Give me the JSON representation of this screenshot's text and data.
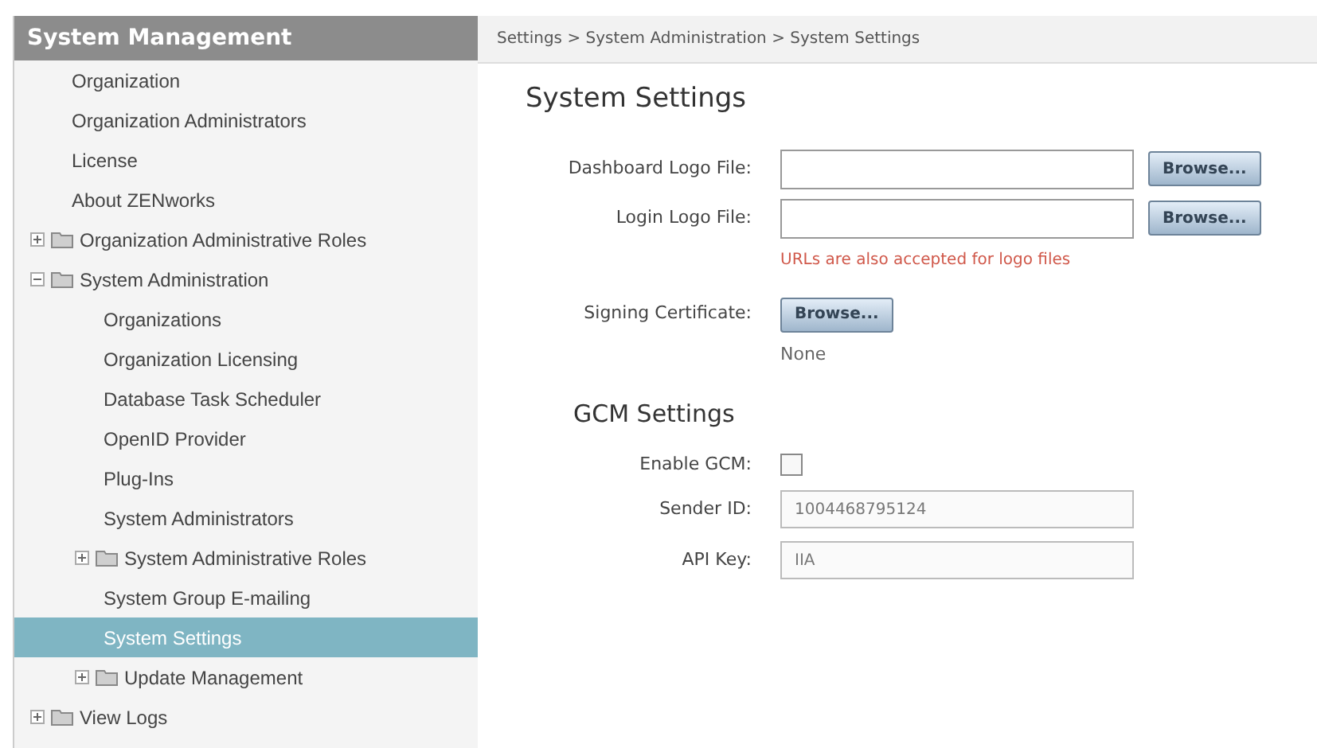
{
  "sidebar": {
    "title": "System Management",
    "items": [
      {
        "label": "Organization",
        "selected": false
      },
      {
        "label": "Organization Administrators",
        "selected": false
      },
      {
        "label": "License",
        "selected": false
      },
      {
        "label": "About ZENworks",
        "selected": false
      },
      {
        "label": "Organization Administrative Roles",
        "selected": false,
        "expanded": false
      },
      {
        "label": "System Administration",
        "selected": false,
        "expanded": true,
        "children": [
          {
            "label": "Organizations",
            "selected": false
          },
          {
            "label": "Organization Licensing",
            "selected": false
          },
          {
            "label": "Database Task Scheduler",
            "selected": false
          },
          {
            "label": "OpenID Provider",
            "selected": false
          },
          {
            "label": "Plug-Ins",
            "selected": false
          },
          {
            "label": "System Administrators",
            "selected": false
          },
          {
            "label": "System Administrative Roles",
            "selected": false,
            "expanded": false
          },
          {
            "label": "System Group E-mailing",
            "selected": false
          },
          {
            "label": "System Settings",
            "selected": true
          },
          {
            "label": "Update Management",
            "selected": false,
            "expanded": false
          }
        ]
      },
      {
        "label": "View Logs",
        "selected": false,
        "expanded": false
      }
    ]
  },
  "breadcrumb": "Settings > System Administration > System Settings",
  "title": "System Settings",
  "logo_fields": [
    {
      "label": "Dashboard Logo File:",
      "button": "Browse..."
    },
    {
      "label": "Login Logo File:",
      "button": "Browse..."
    }
  ],
  "logo_hint": "URLs are also accepted for logo files",
  "signing_certificate": {
    "label": "Signing Certificate:",
    "button": "Browse...",
    "value": "None"
  },
  "gcm": {
    "title": "GCM Settings",
    "enable": {
      "label": "Enable GCM:",
      "checked": false
    },
    "fields": [
      {
        "label": "Sender ID:",
        "value": "1004468795124",
        "disabled": true
      },
      {
        "label": "API Key:",
        "value": "IIA",
        "disabled": true
      }
    ]
  }
}
